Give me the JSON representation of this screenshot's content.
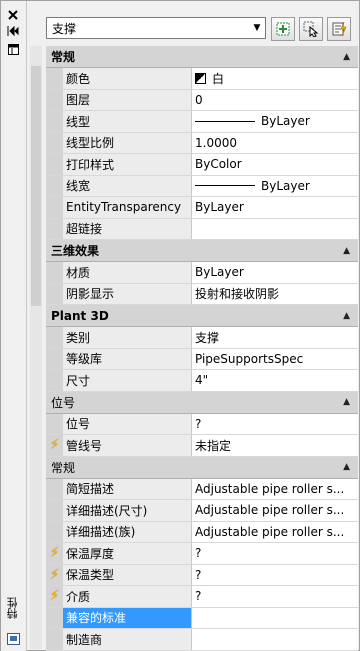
{
  "strip": {
    "title": "特性"
  },
  "toolbar": {
    "object_type": "支撑"
  },
  "categories": [
    {
      "title": "常规",
      "rows": [
        {
          "name": "颜色",
          "value": "白",
          "kind": "color"
        },
        {
          "name": "图层",
          "value": "0"
        },
        {
          "name": "线型",
          "value": "ByLayer",
          "kind": "linetype"
        },
        {
          "name": "线型比例",
          "value": "1.0000"
        },
        {
          "name": "打印样式",
          "value": "ByColor"
        },
        {
          "name": "线宽",
          "value": "ByLayer",
          "kind": "linetype"
        },
        {
          "name": "EntityTransparency",
          "value": "ByLayer"
        },
        {
          "name": "超链接",
          "value": ""
        }
      ]
    },
    {
      "title": "三维效果",
      "rows": [
        {
          "name": "材质",
          "value": "ByLayer"
        },
        {
          "name": "阴影显示",
          "value": "投射和接收阴影"
        }
      ]
    },
    {
      "title": "Plant 3D",
      "rows": [
        {
          "name": "类别",
          "value": "支撑"
        },
        {
          "name": "等级库",
          "value": "PipeSupportsSpec"
        },
        {
          "name": "尺寸",
          "value": "4\""
        }
      ]
    },
    {
      "title": "位号",
      "plain": true,
      "rows": [
        {
          "name": "位号",
          "value": "?"
        },
        {
          "name": "管线号",
          "value": "未指定",
          "lightning": true
        }
      ]
    },
    {
      "title": "常规",
      "plain": true,
      "rows": [
        {
          "name": "简短描述",
          "value": "Adjustable pipe roller s..."
        },
        {
          "name": "详细描述(尺寸)",
          "value": "Adjustable pipe roller s..."
        },
        {
          "name": "详细描述(族)",
          "value": "Adjustable pipe roller s..."
        },
        {
          "name": "保温厚度",
          "value": "?",
          "lightning": true
        },
        {
          "name": "保温类型",
          "value": "?",
          "lightning": true
        },
        {
          "name": "介质",
          "value": "?",
          "lightning": true
        },
        {
          "name": "兼容的标准",
          "value": "",
          "selected": true
        },
        {
          "name": "制造商",
          "value": ""
        }
      ]
    }
  ]
}
